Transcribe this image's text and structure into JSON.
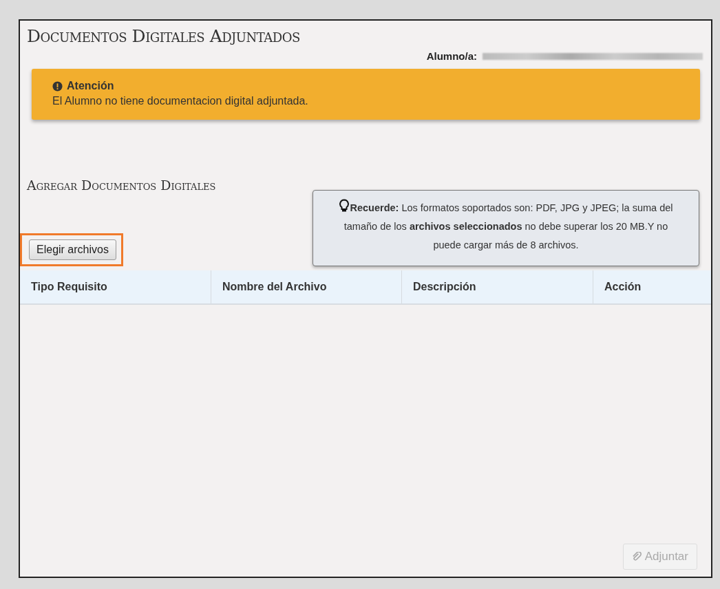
{
  "title": "Documentos Digitales Adjuntados",
  "student": {
    "label": "Alumno/a:"
  },
  "alert": {
    "title": "Atención",
    "message": "El Alumno no tiene documentacion digital adjuntada."
  },
  "section_title": "Agregar Documentos Digitales",
  "tip": {
    "text": "**Recuerde:** Los formatos soportados son: PDF, JPG y JPEG; la suma del tamaño de los **archivos seleccionados** no debe superar los 20 MB.Y no puede cargar más de 8 archivos."
  },
  "choose_button": {
    "label": "Elegir archivos",
    "highlighted": true
  },
  "table": {
    "columns": [
      "Tipo Requisito",
      "Nombre del Archivo",
      "Descripción",
      "Acción"
    ]
  },
  "attach_button": {
    "label": "Adjuntar",
    "disabled": true
  }
}
